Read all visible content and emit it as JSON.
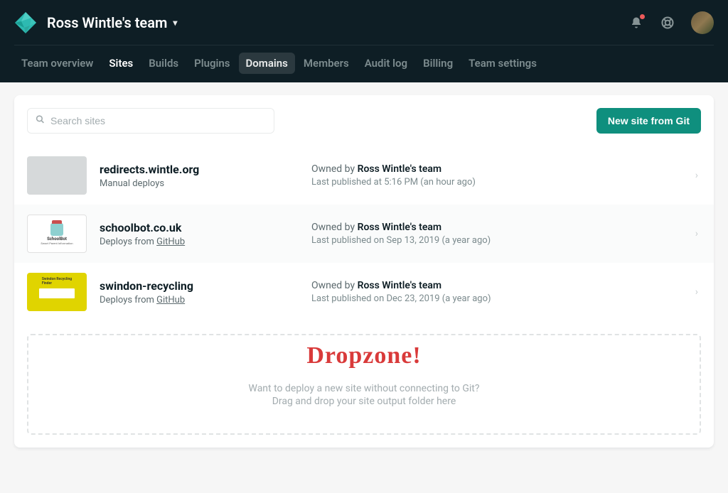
{
  "header": {
    "team_name": "Ross Wintle's team"
  },
  "nav": {
    "items": [
      {
        "label": "Team overview",
        "state": ""
      },
      {
        "label": "Sites",
        "state": "active"
      },
      {
        "label": "Builds",
        "state": ""
      },
      {
        "label": "Plugins",
        "state": ""
      },
      {
        "label": "Domains",
        "state": "highlighted"
      },
      {
        "label": "Members",
        "state": ""
      },
      {
        "label": "Audit log",
        "state": ""
      },
      {
        "label": "Billing",
        "state": ""
      },
      {
        "label": "Team settings",
        "state": ""
      }
    ]
  },
  "toolbar": {
    "search_placeholder": "Search sites",
    "new_site_label": "New site from Git"
  },
  "sites": [
    {
      "name": "redirects.wintle.org",
      "deploy_prefix": "Manual deploys",
      "deploy_link": "",
      "owner_label": "Owned by",
      "owner_name": "Ross Wintle's team",
      "published": "Last published at 5:16 PM (an hour ago)",
      "thumb": "blank",
      "alt": false
    },
    {
      "name": "schoolbot.co.uk",
      "deploy_prefix": "Deploys from ",
      "deploy_link": "GitHub",
      "owner_label": "Owned by",
      "owner_name": "Ross Wintle's team",
      "published": "Last published on Sep 13, 2019 (a year ago)",
      "thumb": "schoolbot",
      "alt": true
    },
    {
      "name": "swindon-recycling",
      "deploy_prefix": "Deploys from ",
      "deploy_link": "GitHub",
      "owner_label": "Owned by",
      "owner_name": "Ross Wintle's team",
      "published": "Last published on Dec 23, 2019 (a year ago)",
      "thumb": "swindon",
      "alt": false
    }
  ],
  "dropzone": {
    "annotation": "Dropzone!",
    "line1": "Want to deploy a new site without connecting to Git?",
    "line2": "Drag and drop your site output folder here"
  }
}
